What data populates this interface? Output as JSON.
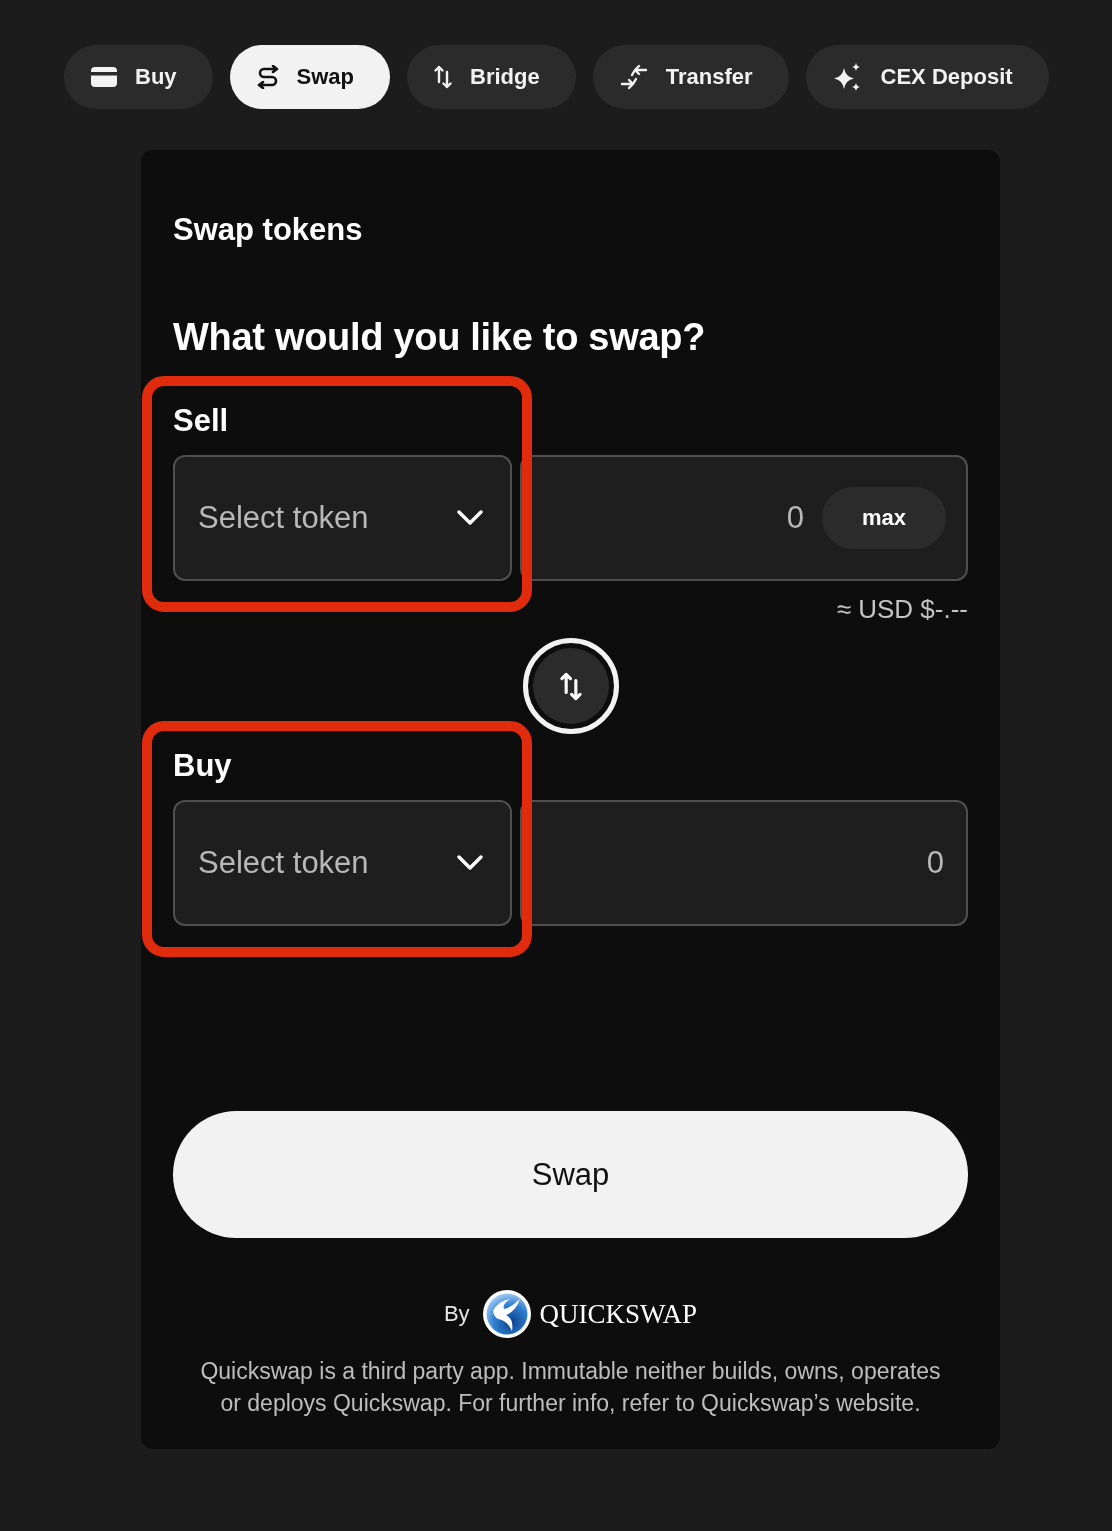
{
  "tabs": [
    {
      "label": "Buy",
      "selected": false
    },
    {
      "label": "Swap",
      "selected": true
    },
    {
      "label": "Bridge",
      "selected": false
    },
    {
      "label": "Transfer",
      "selected": false
    },
    {
      "label": "CEX Deposit",
      "selected": false
    }
  ],
  "card": {
    "title": "Swap tokens",
    "question": "What would you like to swap?",
    "panels": [
      {
        "label": "Sell",
        "highlighted": true,
        "token_select": {
          "placeholder": "Select token"
        },
        "amount_field": {
          "placeholder": "0"
        },
        "max_button": "max",
        "usd_estimate": "≈ USD $-.--"
      },
      {
        "label": "Buy",
        "highlighted": true,
        "token_select": {
          "placeholder": "Select token"
        },
        "amount_field": {
          "placeholder": "0"
        }
      }
    ],
    "swap_button": "Swap",
    "footer": {
      "by": "By",
      "brand": "QUICKSWAP",
      "disclaimer": "Quickswap is a third party app. Immutable neither builds, owns, operates or deploys Quickswap. For further info, refer to Quickswap’s website."
    }
  }
}
